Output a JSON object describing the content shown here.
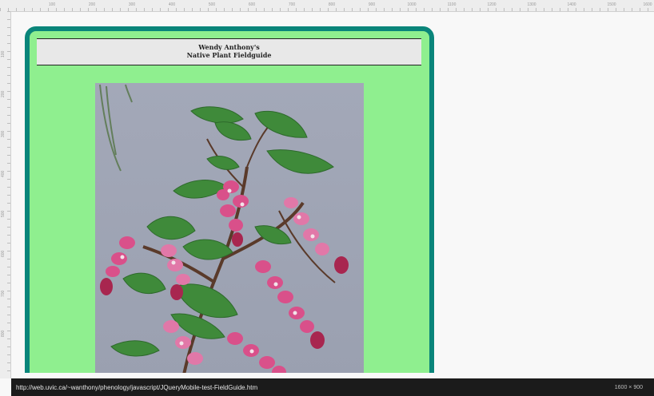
{
  "ruler": {
    "top_labels": [
      "100",
      "200",
      "300",
      "400",
      "500",
      "600",
      "700",
      "800",
      "900",
      "1000",
      "1100",
      "1200",
      "1300",
      "1400",
      "1500",
      "1600"
    ],
    "left_labels": [
      "100",
      "200",
      "300",
      "400",
      "500",
      "600",
      "700",
      "800"
    ]
  },
  "page": {
    "header_line1": "Wendy Anthony's",
    "header_line2": "Native Plant Fieldguide"
  },
  "photo": {
    "subject_icon": "flowering-currant-photo"
  },
  "status_bar": {
    "url": "http://web.uvic.ca/~wanthony/phenology/javascript/JQueryMobile-test-FieldGuide.htm",
    "dimensions": "1600 × 900"
  },
  "colors": {
    "page_background": "#8fef8f",
    "device_border": "#0a857a",
    "header_background": "#e8e8e8",
    "status_bar": "#1b1b1b"
  }
}
